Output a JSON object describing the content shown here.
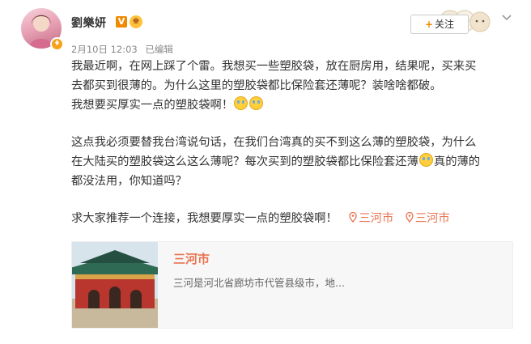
{
  "post": {
    "author": "劉樂妍",
    "verified_badge": "V",
    "date": "2月10日 12:03",
    "edit_status": "已编辑",
    "follow_label": "关注",
    "follow_plus": "+",
    "paragraph1_line1": "我最近啊，在网上踩了个雷。我想买一些塑胶袋，放在厨房用，结果呢，买来买",
    "paragraph1_line2": "去都买到很薄的。为什么这里的塑胶袋都比保险套还薄呢？装啥啥都破。",
    "paragraph1_line3": "我想要买厚实一点的塑胶袋啊！",
    "paragraph2_line1": "这点我必须要替我台湾说句话，在我们台湾真的买不到这么薄的塑胶袋，为什么",
    "paragraph2_line2a": "在大陆买的塑胶袋这么这么薄呢？每次买到的塑胶袋都比保险套还薄",
    "paragraph2_line2b": "真的薄的",
    "paragraph2_line3": "都没法用，你知道吗？",
    "paragraph3": "求大家推荐一个连接，我想要厚实一点的塑胶袋啊！",
    "location_tag1": "三河市",
    "location_tag2": "三河市"
  },
  "card": {
    "title": "三河市",
    "description": "三河是河北省廊坊市代管县级市，地..."
  },
  "colors": {
    "link": "#eb7350",
    "verified": "#f08a00",
    "meta": "#888888",
    "card_bg": "#f7f7f7"
  },
  "icons": {
    "avatar": "avatar",
    "verified": "verified-icon",
    "level": "member-level-icon",
    "follow_decoration": "cartoon-animals-icon",
    "menu": "chevron-down-icon",
    "location": "location-pin-icon",
    "emoji": "crying-emoji-icon"
  }
}
